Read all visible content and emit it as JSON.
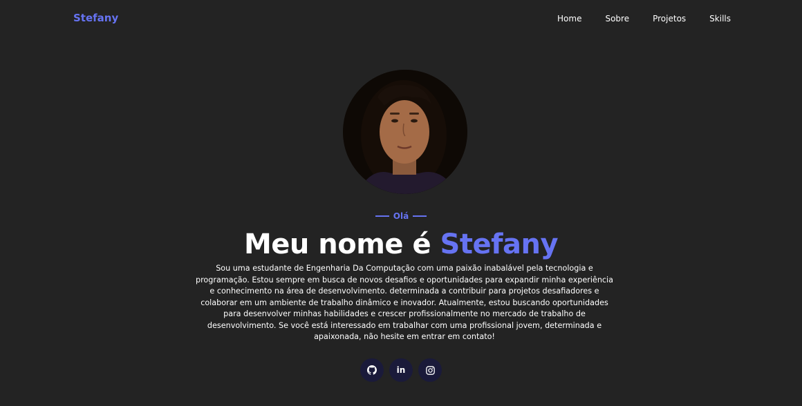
{
  "nav": {
    "brand": "Stefany",
    "links": [
      "Home",
      "Sobre",
      "Projetos",
      "Skills"
    ]
  },
  "hero": {
    "kicker": "Olá",
    "headline_prefix": "Meu nome é ",
    "headline_name": "Stefany",
    "bio": "Sou uma estudante de Engenharia Da Computação com uma paixão inabalável pela tecnologia e programação. Estou sempre em busca de novos desafios e oportunidades para expandir minha experiência e conhecimento na área de desenvolvimento. determinada a contribuir para projetos desafiadores e colaborar em um ambiente de trabalho dinâmico e inovador. Atualmente, estou buscando oportunidades para desenvolver minhas habilidades e crescer profissionalmente no mercado de trabalho de desenvolvimento. Se você está interessado em trabalhar com uma profissional jovem, determinada e apaixonada, não hesite em entrar em contato!"
  },
  "socials": [
    {
      "icon": "github-icon"
    },
    {
      "icon": "linkedin-icon",
      "glyph": "in"
    },
    {
      "icon": "instagram-icon"
    }
  ],
  "colors": {
    "background": "#232323",
    "accent": "#6673f2",
    "text": "#ffffff",
    "social_bg": "#1a1a3a"
  }
}
